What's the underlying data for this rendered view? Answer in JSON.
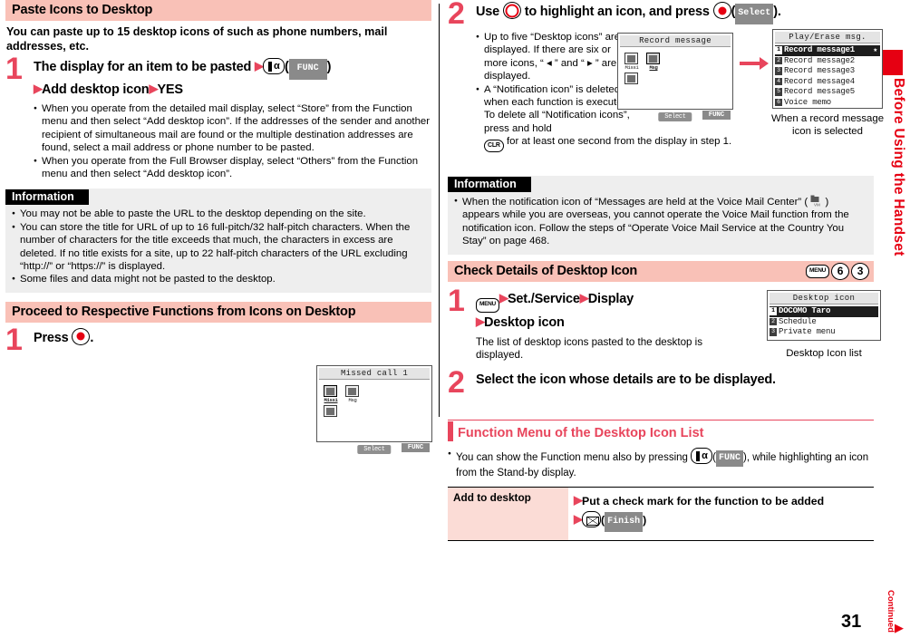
{
  "page_number": "31",
  "side_tab": {
    "label": "Before Using the Handset"
  },
  "footer": {
    "continued": "Continued"
  },
  "colors": {
    "accent_red": "#e60012",
    "step_red": "#e8455c",
    "header_pink": "#f9c1b7",
    "info_grey": "#eeeeee"
  },
  "left_column": {
    "section1": {
      "heading": "Paste Icons to Desktop",
      "intro": "You can paste up to 15 desktop icons of such as phone numbers, mail addresses, etc.",
      "step1": {
        "number": "1",
        "title_part1": "The display for an item to be pasted",
        "key_imode": "i-mode-key",
        "softkey": "FUNC",
        "title_part2": "Add desktop icon",
        "title_part3": "YES",
        "bullets": [
          "When you operate from the detailed mail display, select “Store” from the Function menu and then select “Add desktop icon”. If the addresses of the sender and another recipient of simultaneous mail are found or the multiple destination addresses are found, select a mail address or phone number to be pasted.",
          "When you operate from the Full Browser display, select “Others” from the Function menu and then select “Add desktop icon”."
        ]
      },
      "information": {
        "tag": "Information",
        "bullets": [
          "You may not be able to paste the URL to the desktop depending on the site.",
          "You can store the title for URL of up to 16 full-pitch/32 half-pitch characters. When the number of characters for the title exceeds that much, the characters in excess are deleted. If no title exists for a site, up to 22 half-pitch characters of the URL excluding “http://” or “https://” is displayed.",
          "Some files and data might not be pasted to the desktop."
        ]
      }
    },
    "section2": {
      "heading": "Proceed to Respective Functions from Icons on Desktop",
      "step1": {
        "number": "1",
        "title": "Press",
        "key": "center-select-key"
      },
      "lcd": {
        "title": "Missed call 1",
        "icons": [
          {
            "caption": "Miss1",
            "selected": true
          },
          {
            "caption": "Msg",
            "selected": false
          },
          {
            "caption": "",
            "selected": false
          }
        ],
        "select_label": "Select",
        "func_label": "FUNC"
      }
    }
  },
  "right_column": {
    "step2": {
      "number": "2",
      "title_part1": "Use",
      "key_multi": "multi-direction-key",
      "title_part2": "to highlight an icon, and press",
      "key_center": "center-select-key",
      "softkey": "Select",
      "bullets": [
        "Up to five “Desktop icons” are displayed. If there are six or more icons, “ ◂ ” and “ ▸ ” are displayed.",
        "A “Notification icon” is deleted when each function is executed. To delete all “Notification icons”, press and hold"
      ],
      "clr_key": "CLR",
      "bullet2_tail": "for at least one second from the display in step 1.",
      "lcd_left": {
        "title": "Record message",
        "icons": [
          {
            "caption": "Miss1",
            "selected": false
          },
          {
            "caption": "Msg",
            "selected": true
          },
          {
            "caption": "",
            "selected": false
          }
        ],
        "select_label": "Select",
        "func_label": "FUNC"
      },
      "lcd_right": {
        "title": "Play/Erase msg.",
        "rows": [
          {
            "idx": "1",
            "label": "Record message1",
            "highlighted": true,
            "star": "★"
          },
          {
            "idx": "2",
            "label": "Record message2",
            "highlighted": false
          },
          {
            "idx": "3",
            "label": "Record message3",
            "highlighted": false
          },
          {
            "idx": "4",
            "label": "Record message4",
            "highlighted": false
          },
          {
            "idx": "5",
            "label": "Record message5",
            "highlighted": false
          },
          {
            "idx": "6",
            "label": "Voice memo",
            "highlighted": false
          }
        ],
        "caption": "When a record message icon is selected"
      }
    },
    "information": {
      "tag": "Information",
      "bullet_part1": "When the notification icon of “Messages are held at the Voice Mail Center” (",
      "icon_name": "voice-mail-icon",
      "bullet_part2": ") appears while you are overseas, you cannot operate the Voice Mail function from the notification icon. Follow the steps of “Operate Voice Mail Service at the Country You Stay” on page 468."
    },
    "section3": {
      "heading": "Check Details of Desktop Icon",
      "keys": [
        "MENU",
        "6",
        "3"
      ],
      "step1": {
        "number": "1",
        "key_menu": "MENU",
        "title_part1": "Set./Service",
        "title_part2": "Display",
        "title_part3": "Desktop icon",
        "note": "The list of desktop icons pasted to the desktop is displayed."
      },
      "step2": {
        "number": "2",
        "title": "Select the icon whose details are to be displayed."
      },
      "lcd": {
        "title": "Desktop icon",
        "rows": [
          {
            "idx": "1",
            "label": "DOCOMO Taro",
            "highlighted": true
          },
          {
            "idx": "2",
            "label": "Schedule",
            "highlighted": false
          },
          {
            "idx": "3",
            "label": "Private menu",
            "highlighted": false
          }
        ],
        "caption": "Desktop Icon list"
      }
    },
    "function_menu": {
      "heading": "Function Menu of the Desktop Icon List",
      "note_part1": "You can show the Function menu also by pressing",
      "key_imode": "i-mode-key",
      "softkey": "FUNC",
      "note_part2": ", while highlighting an icon from the Stand-by display.",
      "rows": [
        {
          "key": "Add to desktop",
          "line1": "Put a check mark for the function to be added",
          "line2_key": "mail-key",
          "line2_softkey": "Finish"
        }
      ]
    }
  }
}
